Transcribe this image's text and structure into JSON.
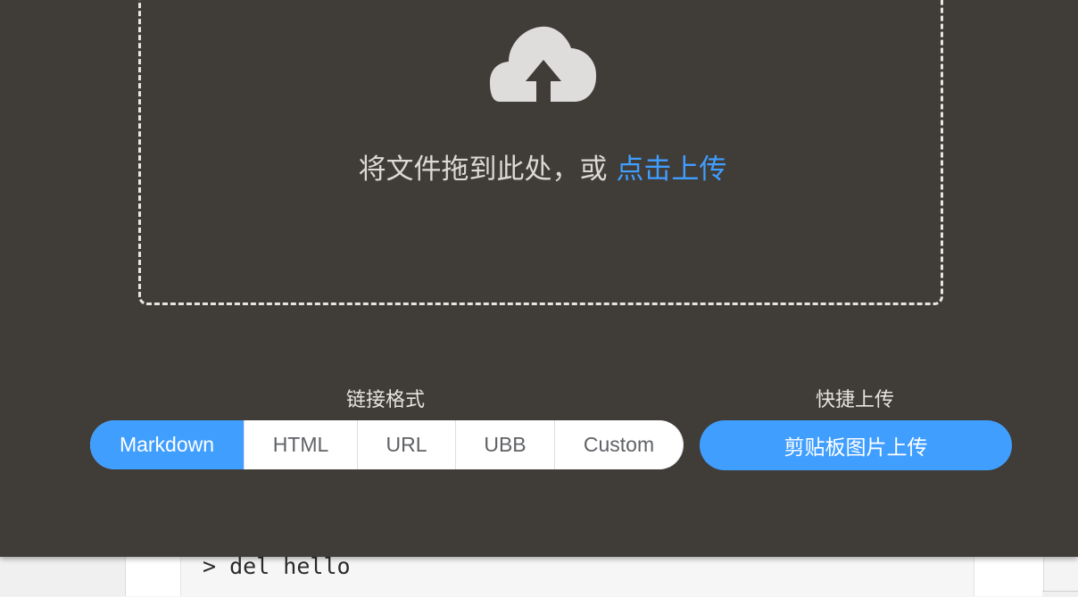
{
  "upload": {
    "drop_text": "将文件拖到此处，或",
    "upload_link": "点击上传"
  },
  "link_format": {
    "label": "链接格式",
    "options": [
      "Markdown",
      "HTML",
      "URL",
      "UBB",
      "Custom"
    ],
    "selected": "Markdown"
  },
  "quick_upload": {
    "label": "快捷上传",
    "button_label": "剪贴板图片上传"
  },
  "background": {
    "code_line": "> del hello"
  },
  "colors": {
    "panel_bg": "#403c38",
    "accent": "#409eff",
    "dashed_border": "#e8e6e3"
  },
  "icons": {
    "upload": "cloud-upload-icon"
  }
}
